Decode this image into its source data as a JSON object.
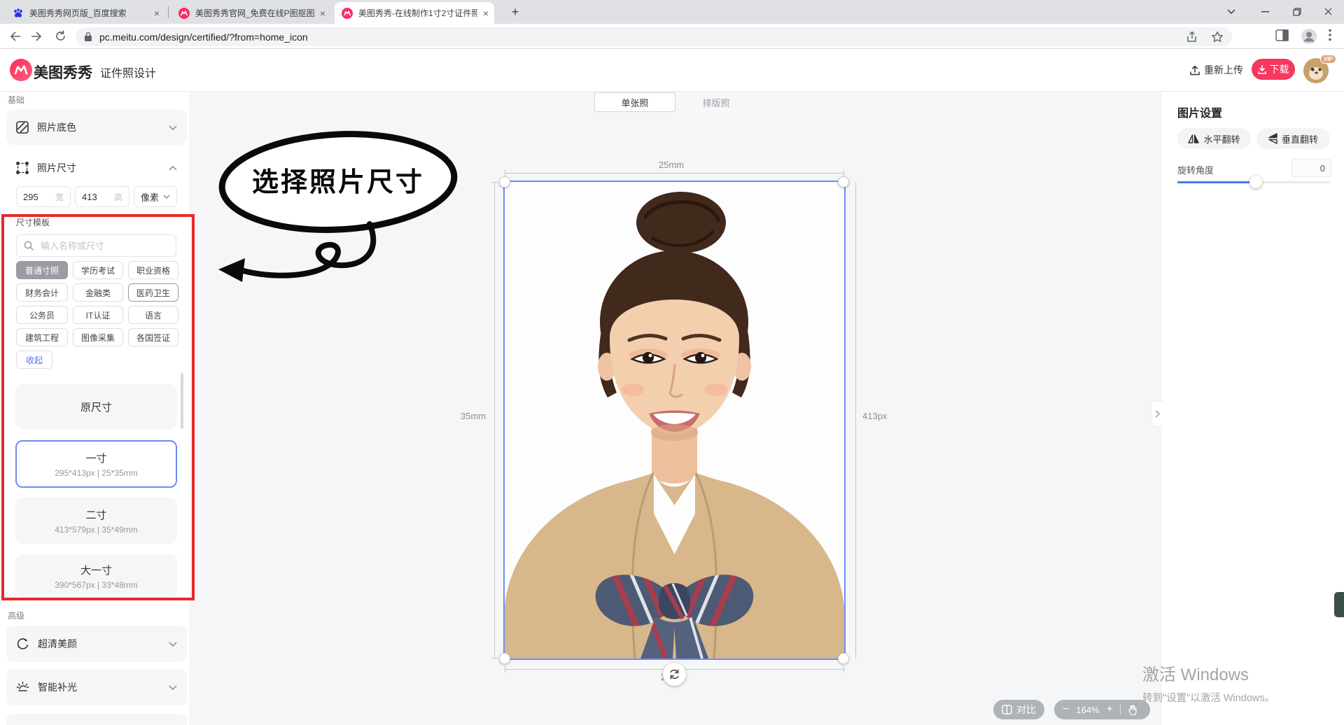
{
  "browser": {
    "tabs": [
      {
        "title": "美图秀秀网页版_百度搜索"
      },
      {
        "title": "美图秀秀官网_免费在线P图抠图"
      },
      {
        "title": "美图秀秀-在线制作1寸2寸证件照"
      }
    ],
    "close_glyph": "×",
    "new_tab_glyph": "+",
    "url": "pc.meitu.com/design/certified/?from=home_icon"
  },
  "header": {
    "brand": "美图秀秀",
    "page": "证件照设计",
    "reupload": "重新上传",
    "download": "下载",
    "vip": "VIP"
  },
  "sidebar": {
    "basic_label": "基础",
    "bg_card": "照片底色",
    "size_card": "照片尺寸",
    "width_value": "295",
    "width_label": "宽",
    "height_value": "413",
    "height_label": "高",
    "unit_label": "像素",
    "template_title": "尺寸模板",
    "search_placeholder": "输入名称或尺寸",
    "chips": [
      "普通寸照",
      "学历考试",
      "职业资格",
      "财务会计",
      "金融类",
      "医药卫生",
      "公务员",
      "IT认证",
      "语言",
      "建筑工程",
      "图像采集",
      "各国签证"
    ],
    "collapse": "收起",
    "templates": [
      {
        "name": "原尺寸",
        "spec": ""
      },
      {
        "name": "一寸",
        "spec": "295*413px | 25*35mm"
      },
      {
        "name": "二寸",
        "spec": "413*579px | 35*49mm"
      },
      {
        "name": "大一寸",
        "spec": "390*567px | 33*48mm"
      }
    ],
    "advanced_label": "高级",
    "beauty_card": "超清美颜",
    "light_card": "智能补光"
  },
  "canvas": {
    "tab_single": "单张照",
    "tab_layout": "排版照",
    "bubble_text": "选择照片尺寸",
    "dim_top": "25mm",
    "dim_left": "35mm",
    "dim_right": "413px",
    "dim_bottom": "295px"
  },
  "panel": {
    "title": "图片设置",
    "flip_h": "水平翻转",
    "flip_v": "垂直翻转",
    "rotate_label": "旋转角度",
    "rotate_value": "0"
  },
  "floatbar": {
    "compare": "对比",
    "zoom_minus": "−",
    "zoom_value": "164%",
    "zoom_plus": "+"
  },
  "watermark": {
    "line1": "激活 Windows",
    "line2": "转到\"设置\"以激活 Windows。"
  },
  "colors": {
    "accent_pink": "#f7375e",
    "accent_blue": "#5b6cf2",
    "select_blue": "#6c8cf5",
    "annotation_red": "#e62a2a"
  }
}
